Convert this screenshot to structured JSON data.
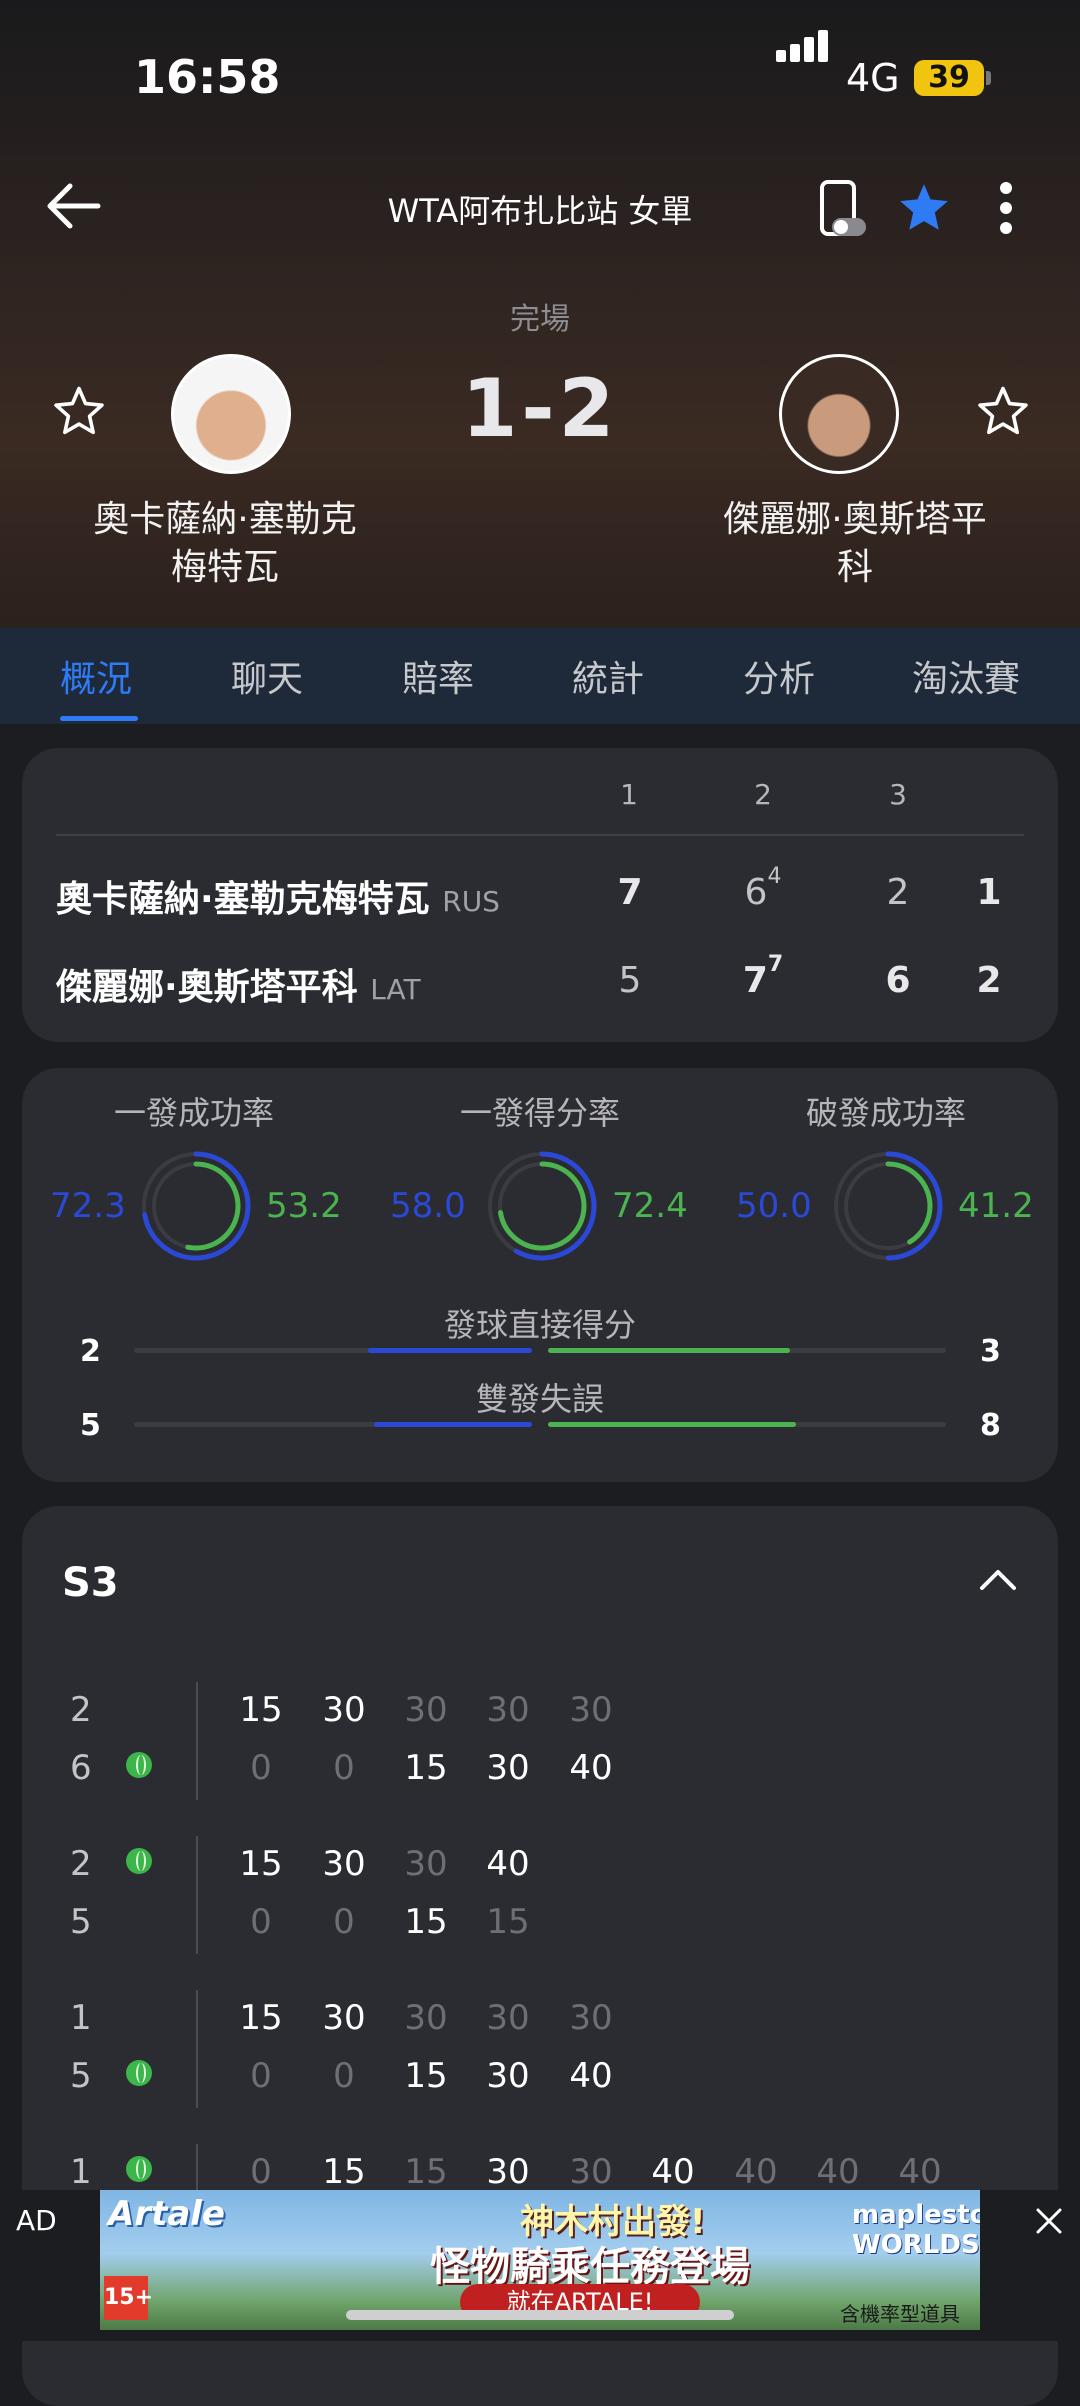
{
  "status_bar": {
    "time": "16:58",
    "network": "4G",
    "battery": "39"
  },
  "header": {
    "title": "WTA阿布扎比站 女單"
  },
  "match": {
    "status": "完場",
    "score": "1-2",
    "player_left": {
      "name_line1": "奧卡薩納·塞勒克",
      "name_line2": "梅特瓦"
    },
    "player_right": {
      "name_line1": "傑麗娜·奧斯塔平",
      "name_line2": "科"
    }
  },
  "tabs": [
    "概況",
    "聊天",
    "賠率",
    "統計",
    "分析",
    "淘汰賽"
  ],
  "scoreboard": {
    "set_headers": [
      "1",
      "2",
      "3"
    ],
    "rows": [
      {
        "name": "奧卡薩納·塞勒克梅特瓦",
        "country": "RUS",
        "s1": "7",
        "s2": "6",
        "s2_tb": "4",
        "s3": "2",
        "sets": "1"
      },
      {
        "name": "傑麗娜·奧斯塔平科",
        "country": "LAT",
        "s1": "5",
        "s2": "7",
        "s2_tb": "7",
        "s3": "6",
        "sets": "2"
      }
    ]
  },
  "stats": {
    "rings": [
      {
        "label": "一發成功率",
        "left": "72.3",
        "right": "53.2"
      },
      {
        "label": "一發得分率",
        "left": "58.0",
        "right": "72.4"
      },
      {
        "label": "破發成功率",
        "left": "50.0",
        "right": "41.2"
      }
    ],
    "bars": [
      {
        "label": "發球直接得分",
        "left": "2",
        "right": "3"
      },
      {
        "label": "雙發失誤",
        "left": "5",
        "right": "8"
      }
    ]
  },
  "set_detail": {
    "title": "S3",
    "games": [
      {
        "top": "2",
        "bottom": "6",
        "top_points": [
          "15",
          "30",
          "30",
          "30",
          "30"
        ],
        "bottom_points": [
          "0",
          "0",
          "15",
          "30",
          "40"
        ]
      },
      {
        "top": "2",
        "bottom": "5",
        "top_points": [
          "15",
          "30",
          "30",
          "40"
        ],
        "bottom_points": [
          "0",
          "0",
          "15",
          "15"
        ]
      },
      {
        "top": "1",
        "bottom": "5",
        "top_points": [
          "15",
          "30",
          "30",
          "30",
          "30"
        ],
        "bottom_points": [
          "0",
          "0",
          "15",
          "30",
          "40"
        ]
      },
      {
        "top": "1",
        "points": [
          "0",
          "15",
          "15",
          "30",
          "30",
          "40",
          "40",
          "40",
          "40"
        ]
      }
    ]
  },
  "ad": {
    "label": "AD",
    "brand": "Artale",
    "headline1": "神木村出發!",
    "headline2": "怪物騎乘任務登場",
    "cta": "就在ARTALE!",
    "brand2": "maplestory WORLDS",
    "rating": "15+",
    "fine_print": "含機率型道具"
  },
  "colors": {
    "accent_blue": "#2f7bf5",
    "serve_blue": "#2b49d6",
    "stat_green": "#4bb34f"
  }
}
